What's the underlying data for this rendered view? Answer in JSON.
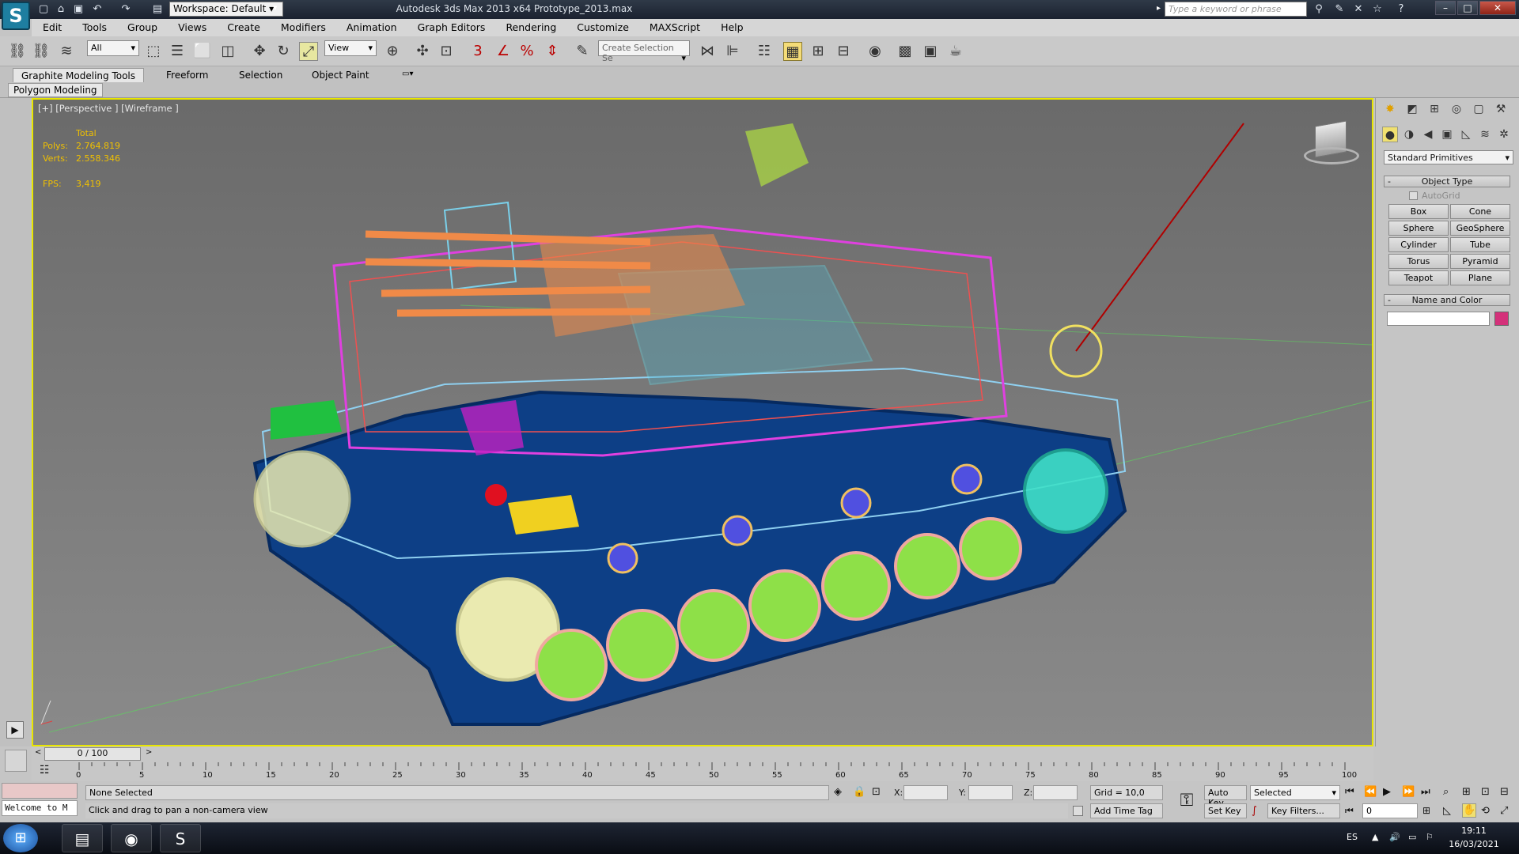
{
  "window": {
    "title": "Autodesk 3ds Max  2013 x64      Prototype_2013.max",
    "workspace": "Workspace: Default",
    "search_placeholder": "Type a keyword or phrase"
  },
  "menu": [
    "Edit",
    "Tools",
    "Group",
    "Views",
    "Create",
    "Modifiers",
    "Animation",
    "Graph Editors",
    "Rendering",
    "Customize",
    "MAXScript",
    "Help"
  ],
  "toolbar": {
    "selection_filter": "All",
    "ref_coord": "View",
    "selection_set_placeholder": "Create Selection Se",
    "snap_label": "3",
    "angle_label": "",
    "percent_label": "%"
  },
  "ribbon": {
    "tabs": [
      "Graphite Modeling Tools",
      "Freeform",
      "Selection",
      "Object Paint"
    ],
    "panel": "Polygon Modeling"
  },
  "viewport": {
    "label": "[+] [Perspective ] [Wireframe ]",
    "stats": {
      "total_label": "Total",
      "polys_label": "Polys:",
      "polys_value": "2.764.819",
      "verts_label": "Verts:",
      "verts_value": "2.558.346",
      "fps_label": "FPS:",
      "fps_value": "3,419"
    }
  },
  "command_panel": {
    "dropdown": "Standard Primitives",
    "object_type_title": "Object Type",
    "autogrid": "AutoGrid",
    "buttons": [
      "Box",
      "Cone",
      "Sphere",
      "GeoSphere",
      "Cylinder",
      "Tube",
      "Torus",
      "Pyramid",
      "Teapot",
      "Plane"
    ],
    "name_color_title": "Name and Color",
    "color_swatch": "#d4317a"
  },
  "timeline": {
    "frame_display": "0 / 100",
    "ticks": [
      "0",
      "5",
      "10",
      "15",
      "20",
      "25",
      "30",
      "35",
      "40",
      "45",
      "50",
      "55",
      "60",
      "65",
      "70",
      "75",
      "80",
      "85",
      "90",
      "95",
      "100"
    ]
  },
  "status": {
    "maxscript": "Welcome to M",
    "selection": "None Selected",
    "prompt": "Click and drag to pan a non-camera view",
    "x_label": "X:",
    "y_label": "Y:",
    "z_label": "Z:",
    "grid": "Grid = 10,0",
    "add_time_tag": "Add Time Tag",
    "auto_key": "Auto Key",
    "set_key": "Set Key",
    "key_mode": "Selected",
    "key_filters": "Key Filters...",
    "frame": "0"
  },
  "taskbar": {
    "lang": "ES",
    "time": "19:11",
    "date": "16/03/2021"
  }
}
